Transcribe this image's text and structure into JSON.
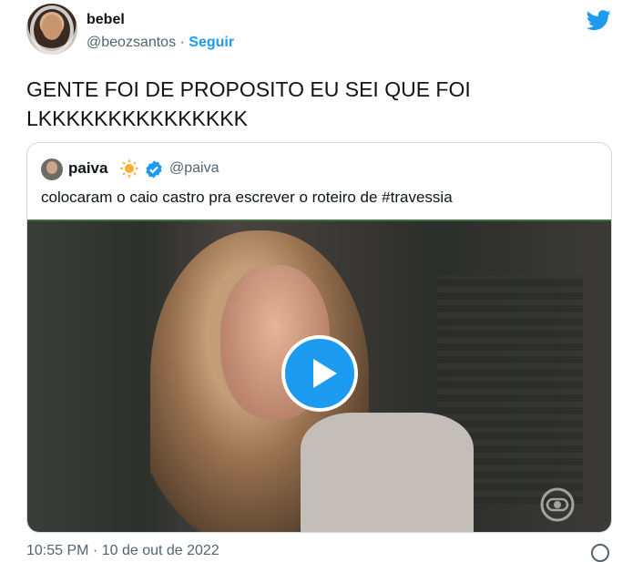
{
  "author": {
    "name": "bebel",
    "handle": "@beozsantos",
    "separator": " · ",
    "follow_label": "Seguir"
  },
  "tweet": {
    "text": "GENTE FOI DE PROPOSITO EU SEI QUE FOI\nLKKKKKKKKKKKKKKK"
  },
  "quoted": {
    "name": "paiva",
    "handle": "@paiva",
    "text": "colocaram o caio castro pra escrever o roteiro de #travessia"
  },
  "footer": {
    "timestamp": "10:55 PM · 10 de out de 2022"
  },
  "colors": {
    "accent": "#1d9bf0",
    "text": "#0f1419",
    "secondary": "#536471",
    "border": "#cfd9de"
  },
  "icons": {
    "logo": "twitter-bird-icon",
    "quoted_emoji": "sun-icon",
    "verified": "verified-badge-icon",
    "play": "play-icon",
    "watermark": "globoplay-watermark-icon",
    "info": "info-icon"
  }
}
